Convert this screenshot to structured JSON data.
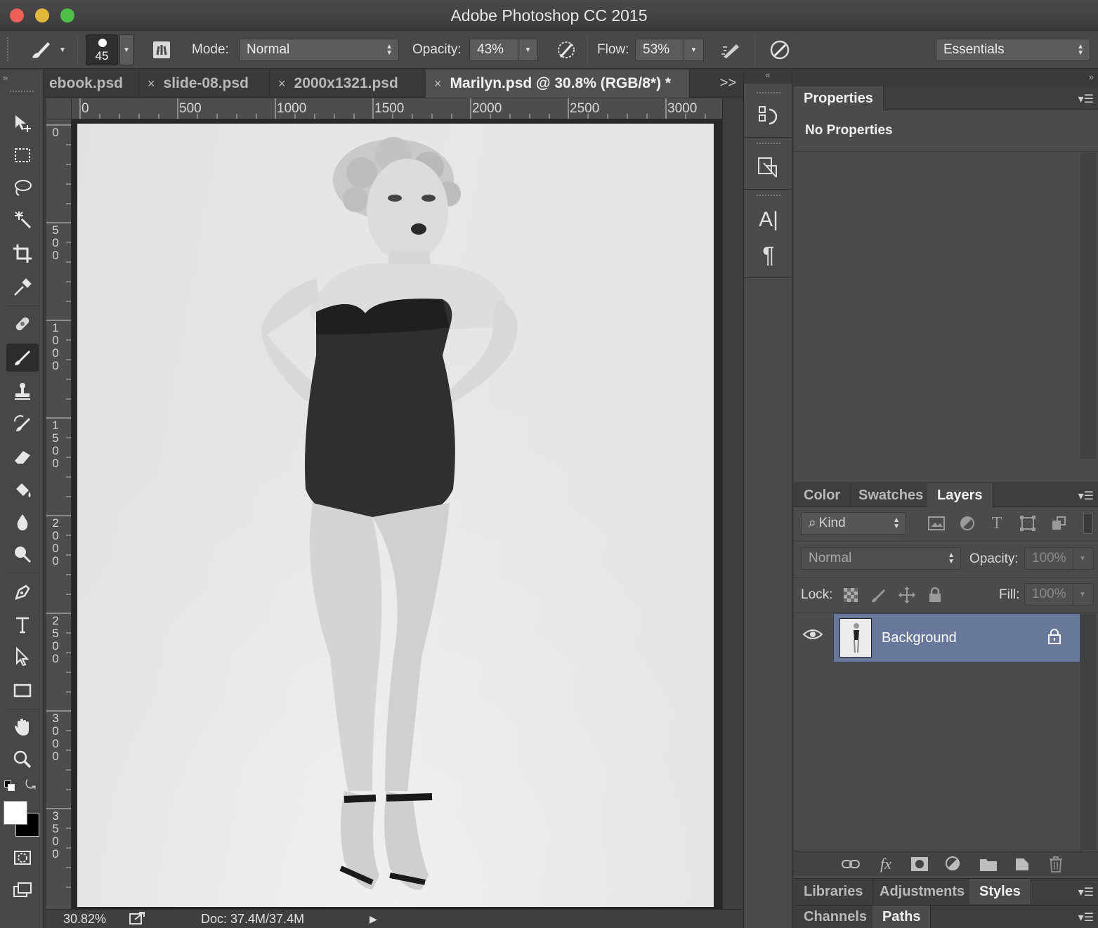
{
  "window": {
    "title": "Adobe Photoshop CC 2015"
  },
  "options_bar": {
    "brush_size": "45",
    "mode_label": "Mode:",
    "mode_value": "Normal",
    "opacity_label": "Opacity:",
    "opacity_value": "43%",
    "flow_label": "Flow:",
    "flow_value": "53%",
    "workspace": "Essentials"
  },
  "tabs": [
    {
      "label": "ebook.psd",
      "active": false
    },
    {
      "label": "slide-08.psd",
      "active": false
    },
    {
      "label": "2000x1321.psd",
      "active": false
    },
    {
      "label": "Marilyn.psd @ 30.8% (RGB/8*) *",
      "active": true
    }
  ],
  "tab_close": "×",
  "tab_more": ">>",
  "ruler_top": [
    "0",
    "500",
    "1000",
    "1500",
    "2000",
    "2500",
    "3000"
  ],
  "ruler_left": [
    "0",
    "500",
    "1000",
    "1500",
    "2000",
    "2500",
    "3000",
    "3500"
  ],
  "status": {
    "zoom": "30.82%",
    "doc": "Doc: 37.4M/37.4M"
  },
  "properties_panel": {
    "tab": "Properties",
    "message": "No Properties"
  },
  "layers_panel": {
    "tabs": [
      "Color",
      "Swatches",
      "Layers"
    ],
    "active_tab": "Layers",
    "filter_kind": "Kind",
    "blend_mode": "Normal",
    "opacity_label": "Opacity:",
    "opacity_value": "100%",
    "lock_label": "Lock:",
    "fill_label": "Fill:",
    "fill_value": "100%",
    "layers": [
      {
        "name": "Background",
        "locked": true,
        "visible": true
      }
    ]
  },
  "bottom_panels": {
    "row1": [
      "Libraries",
      "Adjustments",
      "Styles"
    ],
    "row1_active": "Styles",
    "row2": [
      "Channels",
      "Paths"
    ],
    "row2_active": "Paths"
  },
  "colors": {
    "selection": "#67789a",
    "background": "#3c3c3c",
    "panel": "#4b4b4b"
  }
}
